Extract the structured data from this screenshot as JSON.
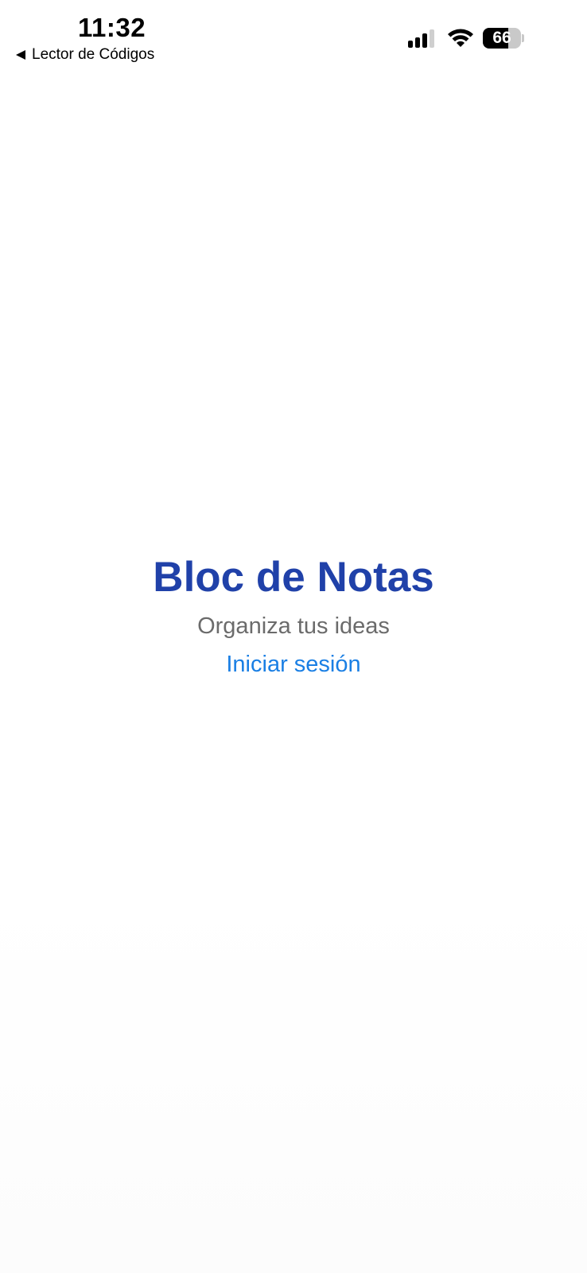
{
  "status_bar": {
    "time": "11:32",
    "back_app": "Lector de Códigos",
    "battery_percent": 66,
    "battery_label": "66",
    "signal_bars_active": 3,
    "signal_bars_total": 4
  },
  "main": {
    "title": "Bloc de Notas",
    "subtitle": "Organiza tus ideas",
    "login_link": "Iniciar sesión"
  },
  "colors": {
    "title": "#2041a9",
    "subtitle": "#6b6b6b",
    "link": "#1a7fe4"
  },
  "icons": {
    "back": "back-arrow-icon",
    "signal": "cellular-signal-icon",
    "wifi": "wifi-icon",
    "battery": "battery-icon"
  }
}
